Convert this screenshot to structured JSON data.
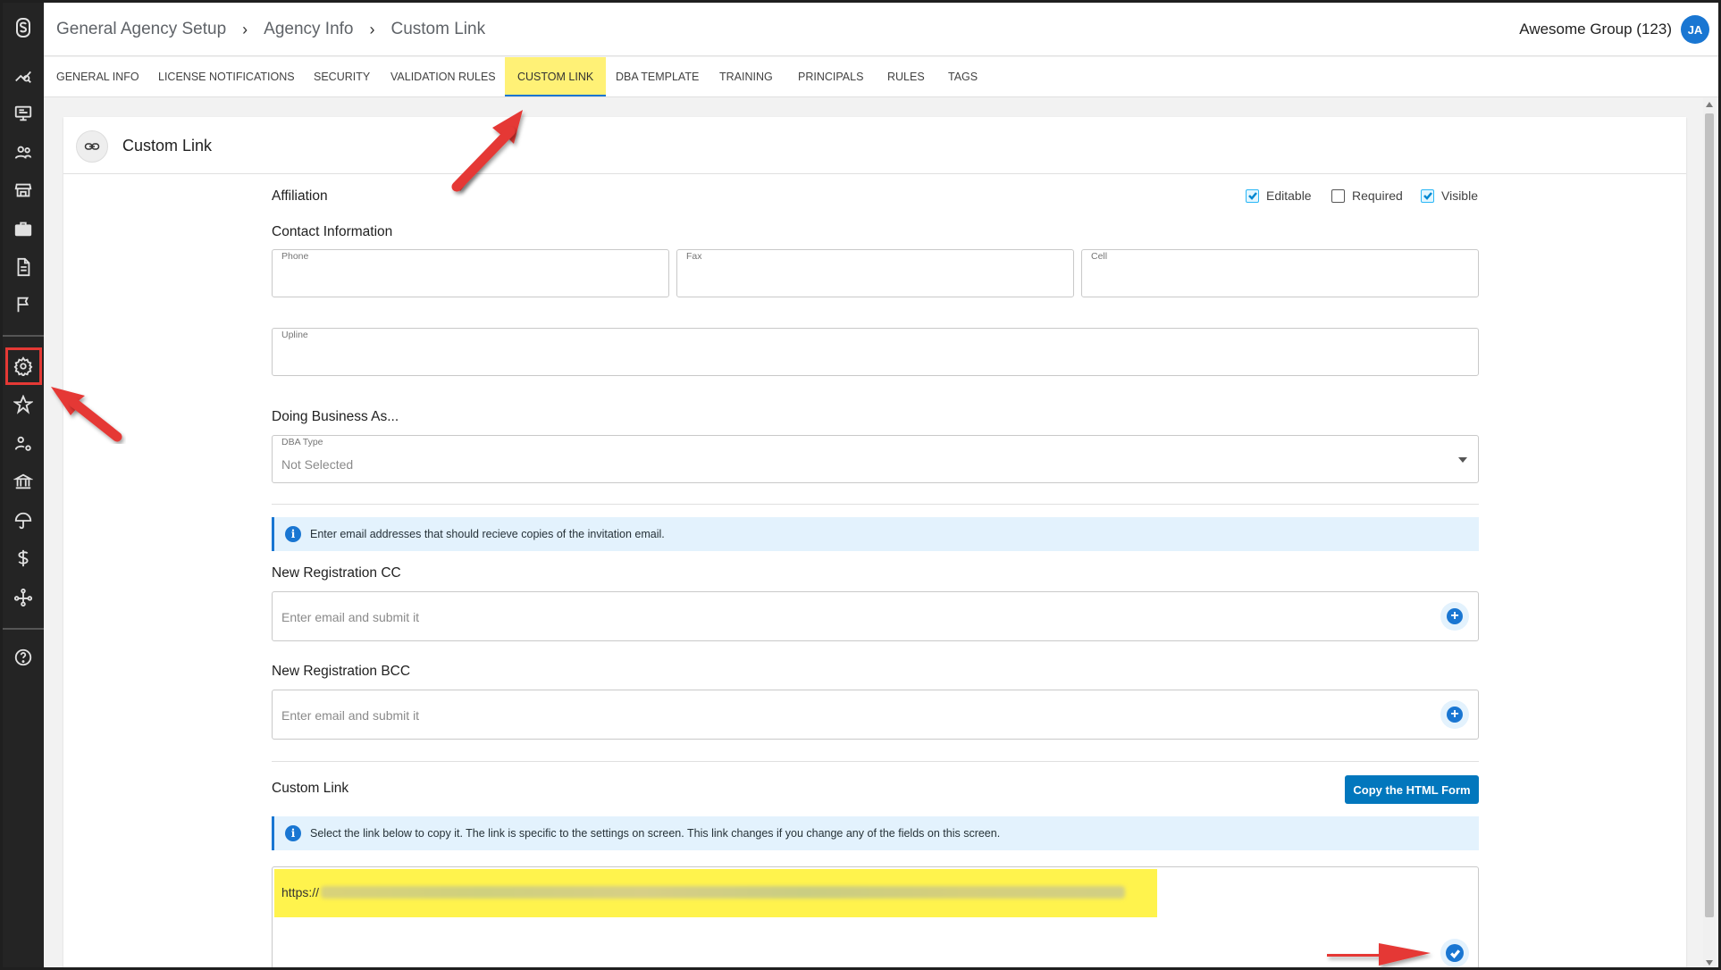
{
  "breadcrumb": [
    "General Agency Setup",
    "Agency Info",
    "Custom Link"
  ],
  "account": {
    "name": "Awesome Group (123)",
    "initials": "JA"
  },
  "tabs": [
    "GENERAL INFO",
    "LICENSE NOTIFICATIONS",
    "SECURITY",
    "VALIDATION RULES",
    "CUSTOM LINK",
    "DBA TEMPLATE",
    "TRAINING",
    "PRINCIPALS",
    "RULES",
    "TAGS"
  ],
  "active_tab": "CUSTOM LINK",
  "rail_icons": [
    "logo-icon",
    "analytics-icon",
    "monitor-icon",
    "people-icon",
    "store-icon",
    "briefcase-icon",
    "document-icon",
    "flag-icon",
    "settings-icon",
    "star-icon",
    "user-settings-icon",
    "bank-icon",
    "umbrella-icon",
    "dollar-icon",
    "hierarchy-icon",
    "help-icon"
  ],
  "card": {
    "title": "Custom Link"
  },
  "affiliation": {
    "title": "Affiliation",
    "checkboxes": [
      {
        "label": "Editable",
        "checked": true
      },
      {
        "label": "Required",
        "checked": false
      },
      {
        "label": "Visible",
        "checked": true
      }
    ]
  },
  "contact": {
    "title": "Contact Information",
    "phone_label": "Phone",
    "fax_label": "Fax",
    "cell_label": "Cell",
    "upline_label": "Upline"
  },
  "dba": {
    "title": "Doing Business As...",
    "type_label": "DBA Type",
    "type_value": "Not Selected"
  },
  "invite_info": "Enter email addresses that should recieve copies of the invitation email.",
  "cc": {
    "title": "New Registration CC",
    "placeholder": "Enter email and submit it"
  },
  "bcc": {
    "title": "New Registration BCC",
    "placeholder": "Enter email and submit it"
  },
  "custom_link": {
    "title": "Custom Link",
    "copy_button": "Copy the HTML Form",
    "info": "Select the link below to copy it. The link is specific to the settings on screen. This link changes if you change any of the fields on this screen.",
    "url_prefix": "https://"
  },
  "colors": {
    "accent": "#1976d2",
    "highlight": "#fff34d",
    "annotation": "#e53935",
    "rail": "#242424"
  }
}
